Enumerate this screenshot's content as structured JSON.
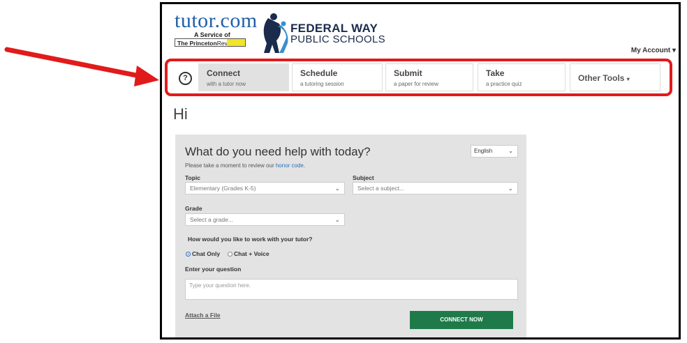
{
  "logo": {
    "tutor": "tutor.com",
    "service": "A Service of",
    "princeton_bold": "The Princeton",
    "princeton_rest": "Review"
  },
  "district": {
    "line1": "FEDERAL WAY",
    "line2": "PUBLIC SCHOOLS"
  },
  "header": {
    "my_account": "My Account"
  },
  "nav": {
    "help": "?",
    "tabs": [
      {
        "title": "Connect",
        "subtitle": "with a tutor now"
      },
      {
        "title": "Schedule",
        "subtitle": "a tutoring session"
      },
      {
        "title": "Submit",
        "subtitle": "a paper for review"
      },
      {
        "title": "Take",
        "subtitle": "a practice quiz"
      }
    ],
    "other_tools": "Other Tools"
  },
  "greeting": "Hi",
  "form": {
    "title": "What do you need help with today?",
    "language": "English",
    "honor_prefix": "Please take a moment to review our ",
    "honor_link": "honor code",
    "honor_suffix": ".",
    "topic_label": "Topic",
    "topic_value": "Elementary (Grades K-5)",
    "subject_label": "Subject",
    "subject_placeholder": "Select a subject...",
    "grade_label": "Grade",
    "grade_placeholder": "Select a grade...",
    "mode_question": "How would you like to work with your tutor?",
    "mode_options": [
      "Chat Only",
      "Chat + Voice"
    ],
    "question_label": "Enter your question",
    "question_placeholder": "Type your question here.",
    "attach_label": "Attach a File",
    "connect_label": "CONNECT NOW"
  },
  "colors": {
    "annotation_red": "#e11b1b",
    "connect_green": "#1f7a4a",
    "link_blue": "#2a6ebb",
    "panel_gray": "#e3e3e3"
  }
}
